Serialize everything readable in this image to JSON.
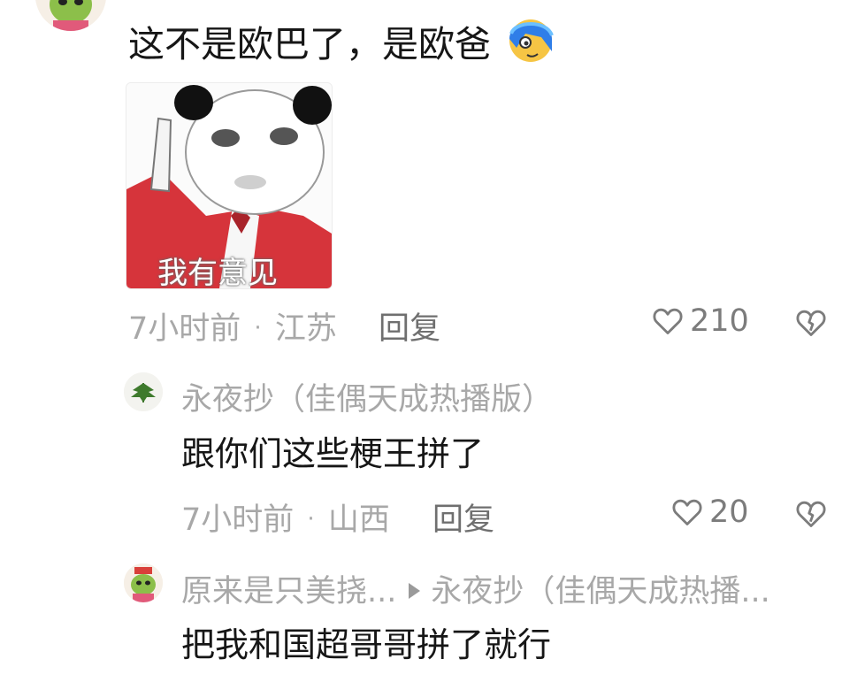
{
  "comment": {
    "text": "这不是欧巴了，是欧爸",
    "sticker_caption": "我有意见",
    "time": "7小时前",
    "location": "江苏",
    "reply_label": "回复",
    "likes": "210"
  },
  "replies": [
    {
      "username": "永夜抄（佳偶天成热播版）",
      "text": "跟你们这些梗王拼了",
      "time": "7小时前",
      "location": "山西",
      "reply_label": "回复",
      "likes": "20"
    },
    {
      "username": "原来是只美挠...",
      "reply_to": "永夜抄（佳偶天成热播...",
      "text": "把我和国超哥哥拼了就行"
    }
  ],
  "separator": "·",
  "colors": {
    "text_primary": "#161616",
    "text_meta": "#a8a8a8",
    "reply_button": "#6f6f6f",
    "icon": "#7c7c7c"
  }
}
